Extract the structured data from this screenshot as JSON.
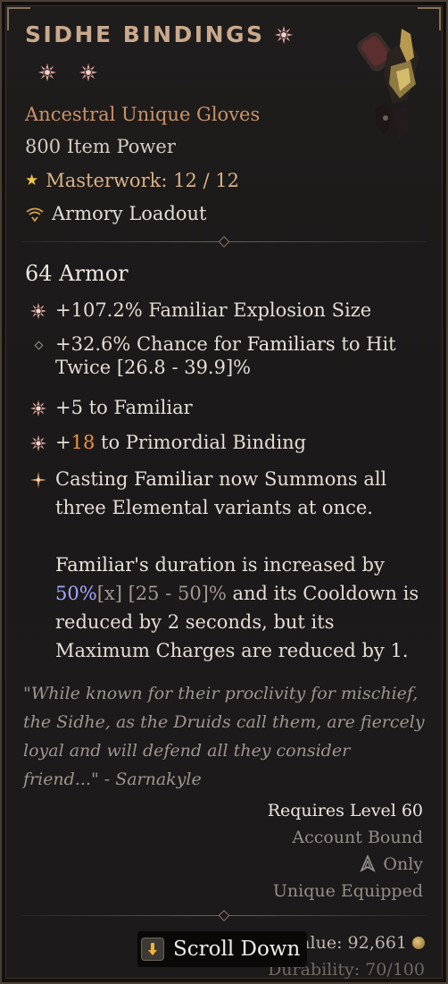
{
  "item": {
    "name": "SIDHE BINDINGS",
    "subtitle": "Ancestral Unique Gloves",
    "item_power": "800 Item Power",
    "masterwork": "Masterwork: 12 / 12",
    "loadout": "Armory Loadout",
    "armor": "64 Armor"
  },
  "affixes": [
    {
      "text": "+107.2% Familiar Explosion Size"
    },
    {
      "p1": "+32.6% Chance for ",
      "p2": "Familiars",
      "p3": " to Hit",
      "line2": "Twice [26.8 - 39.9]%"
    },
    {
      "text": "+5 to Familiar"
    },
    {
      "p1": "+",
      "p2": "18",
      "p3": " to Primordial Binding"
    }
  ],
  "unique_power": {
    "w1": "Casting ",
    "w2": "Familiar",
    "w3": " now Summons all",
    "w4": "three Elemental variants at once.",
    "p2_a": "Familiar's",
    "p2_b": " duration is increased by",
    "p2_c": "50%",
    "p2_d": "[x]",
    "p2_e": " [25 - 50]%",
    "p2_f": " and its Cooldown is",
    "p2_g": "reduced by 2 seconds, but its",
    "p2_h": "Maximum Charges are reduced by 1."
  },
  "flavor": {
    "l1": "\"While known for their proclivity for mischief,",
    "l2": "the Sidhe, as the Druids call them, are fiercely",
    "l3": "loyal and will defend all they consider",
    "l4": "friend...\"  - Sarnakyle"
  },
  "requirements": {
    "level": "Requires Level 60",
    "bound": "Account Bound",
    "class_only": "Only",
    "unique": "Unique Equipped"
  },
  "footer": {
    "sell_value": "l Value: 92,661",
    "durability": "Durability: 70/100",
    "scroll": "Scroll Down"
  },
  "colors": {
    "title": "#c9a98d",
    "unique_text": "#e2b07f",
    "highlight_orange": "#e9953e",
    "highlight_blue": "#a2a8ff"
  }
}
